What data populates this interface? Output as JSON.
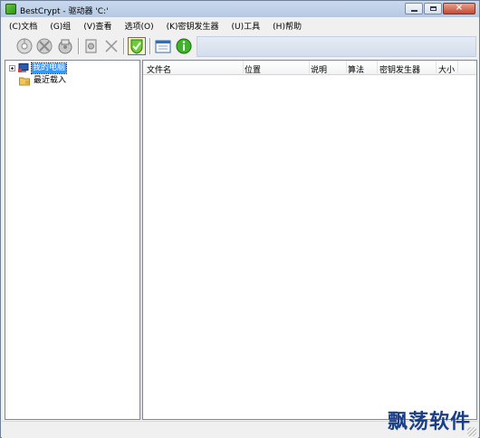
{
  "window": {
    "title": "BestCrypt - 驱动器 'C:'"
  },
  "menu": {
    "items": [
      {
        "label": "(C)文档"
      },
      {
        "label": "(G)组"
      },
      {
        "label": "(V)查看"
      },
      {
        "label": "选项(O)"
      },
      {
        "label": "(K)密钥发生器"
      },
      {
        "label": "(U)工具"
      },
      {
        "label": "(H)帮助"
      }
    ]
  },
  "toolbar": {
    "buttons": [
      {
        "icon": "mount-disk-icon"
      },
      {
        "icon": "dismount-disk-icon"
      },
      {
        "icon": "container-properties-icon"
      },
      {
        "icon": "document-icon"
      },
      {
        "icon": "delete-x-icon"
      },
      {
        "icon": "bestcrypt-shield-icon"
      },
      {
        "icon": "calendar-view-icon"
      },
      {
        "icon": "info-icon"
      }
    ]
  },
  "tree": {
    "items": [
      {
        "label": "我的电脑",
        "icon": "computer-icon",
        "selected": true
      },
      {
        "label": "最近载入",
        "icon": "folder-icon",
        "selected": false
      }
    ]
  },
  "list": {
    "columns": [
      {
        "label": "文件名"
      },
      {
        "label": "位置"
      },
      {
        "label": "说明"
      },
      {
        "label": "算法"
      },
      {
        "label": "密钥发生器"
      },
      {
        "label": "大小"
      }
    ]
  },
  "statusbar": {
    "watermark": "飘荡软件"
  },
  "colors": {
    "selection": "#3399ff",
    "title_gradient": "#c9d9ee",
    "close_button": "#c14b34"
  }
}
